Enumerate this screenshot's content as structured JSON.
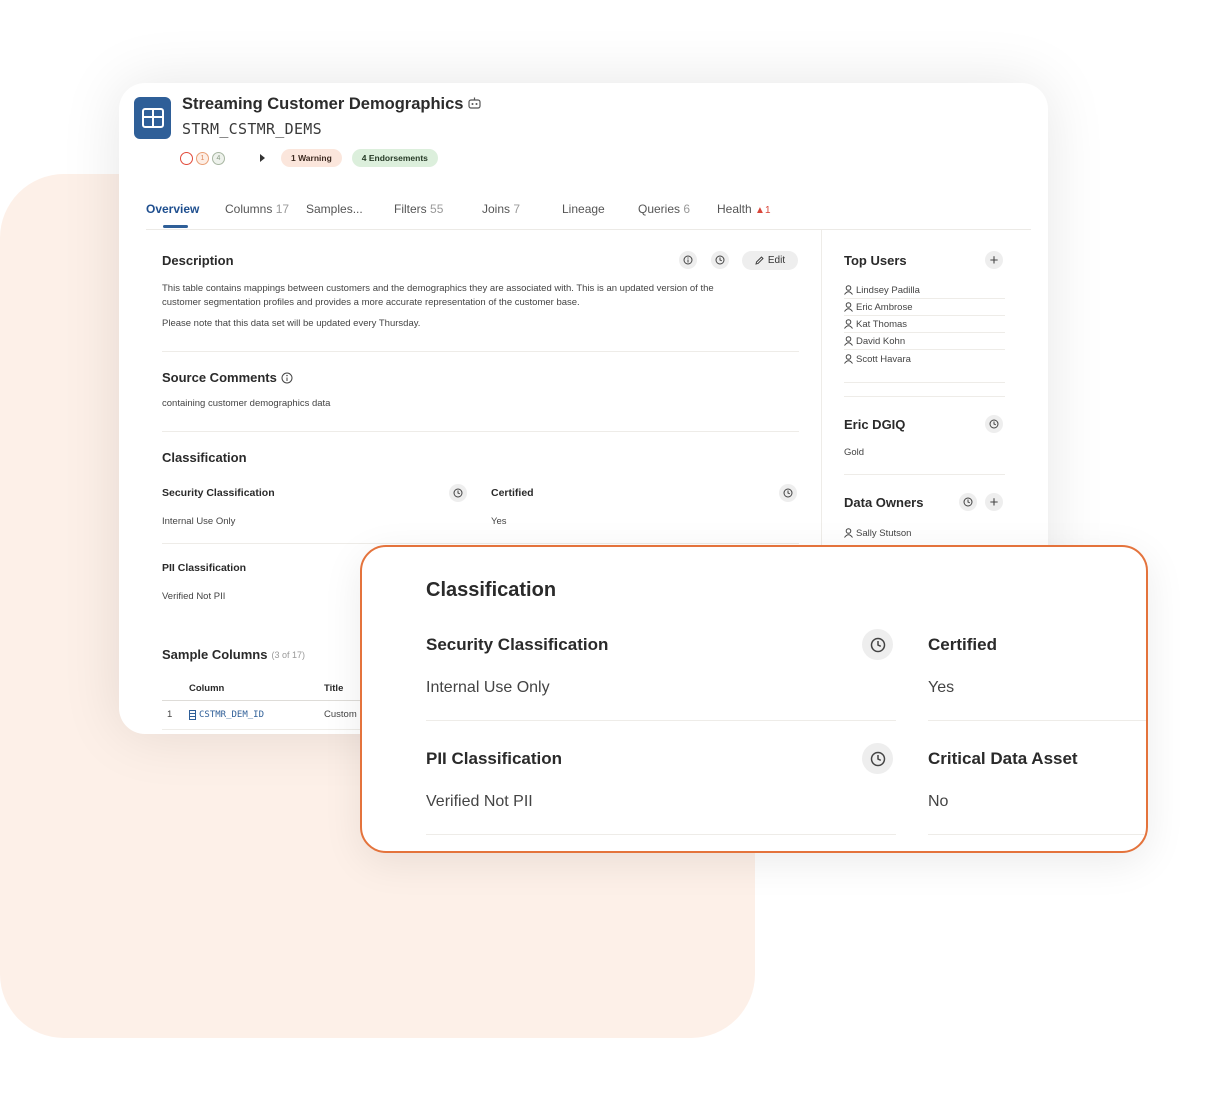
{
  "dataset": {
    "title": "Streaming Customer Demographics",
    "technical_name": "STRM_CSTMR_DEMS",
    "status_counts": {
      "orange": "1",
      "green": "4"
    },
    "warning_badge": "1 Warning",
    "endorsement_badge": "4 Endorsements"
  },
  "tabs": [
    {
      "label": "Overview",
      "count": ""
    },
    {
      "label": "Columns",
      "count": "17"
    },
    {
      "label": "Samples...",
      "count": ""
    },
    {
      "label": "Filters",
      "count": "55"
    },
    {
      "label": "Joins",
      "count": "7"
    },
    {
      "label": "Lineage",
      "count": ""
    },
    {
      "label": "Queries",
      "count": "6"
    },
    {
      "label": "Health",
      "count": "1"
    }
  ],
  "description": {
    "heading": "Description",
    "edit_label": "Edit",
    "line1": "This table contains mappings between customers and the demographics they are associated with.  This is an updated version of the",
    "line2": "customer segmentation profiles and provides a more accurate representation of the customer base.",
    "line3": "Please note that this data set will be updated every Thursday."
  },
  "source_comments": {
    "heading": "Source Comments",
    "text": "containing customer demographics data"
  },
  "classification": {
    "heading": "Classification",
    "security_label": "Security Classification",
    "security_value": "Internal Use Only",
    "certified_label": "Certified",
    "certified_value": "Yes",
    "pii_label": "PII Classification",
    "pii_value": "Verified Not PII",
    "critical_label": "Critical Data Asset",
    "critical_value": "No"
  },
  "sample_columns": {
    "heading": "Sample Columns",
    "count": "(3 of 17)",
    "col_header": "Column",
    "title_header": "Title",
    "rows": [
      {
        "index": "1",
        "column": "CSTMR_DEM_ID",
        "title": "Custom"
      }
    ]
  },
  "top_users": {
    "heading": "Top Users",
    "users": [
      "Lindsey Padilla",
      "Eric Ambrose",
      "Kat Thomas",
      "David Kohn",
      "Scott Havara"
    ]
  },
  "dgiq": {
    "heading": "Eric DGIQ",
    "value": "Gold"
  },
  "data_owners": {
    "heading": "Data Owners",
    "owners": [
      "Sally Stutson"
    ]
  }
}
